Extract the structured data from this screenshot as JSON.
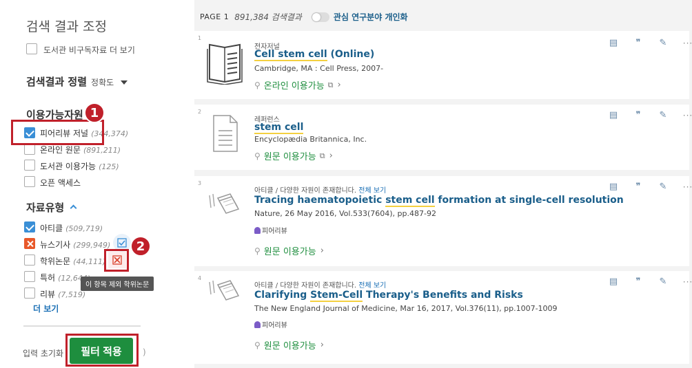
{
  "sidebar": {
    "title": "검색 결과 조정",
    "library_nonsub": "도서관 비구독자료 더 보기",
    "sort": {
      "title": "검색결과 정렬",
      "value": "정확도"
    },
    "availability": {
      "title": "이용가능자원",
      "items": [
        {
          "label": "피어리뷰 저널",
          "count": "(344,374)"
        },
        {
          "label": "온라인 원문",
          "count": "(891,211)"
        },
        {
          "label": "도서관 이용가능",
          "count": "(125)"
        },
        {
          "label": "오픈 액세스",
          "count": ""
        }
      ]
    },
    "rtype": {
      "title": "자료유형",
      "items": [
        {
          "label": "아티클",
          "count": "(509,719)"
        },
        {
          "label": "뉴스기사",
          "count": "(299,949)"
        },
        {
          "label": "학위논문",
          "count": "(44,111)"
        },
        {
          "label": "특허",
          "count": "(12,644)"
        },
        {
          "label": "리뷰",
          "count": "(7,519)"
        }
      ]
    },
    "more_label": "더 보기",
    "tooltip": "이 항목 제외 학위논문",
    "reset_label": "입력 초기화",
    "apply_label": "필터 적용",
    "paren": ")",
    "badges": [
      "1",
      "2"
    ]
  },
  "main": {
    "page_label": "PAGE 1",
    "result_count": "891,384 검색결과",
    "personalize_label": "관심 연구분야 개인화",
    "results": [
      {
        "num": "1",
        "type": "전자저널",
        "title_pre": "",
        "title_hl": "Cell stem cell",
        "title_post": " (Online)",
        "pub": "Cambridge, MA : Cell Press, 2007-",
        "peer": "",
        "avail": "온라인 이용가능"
      },
      {
        "num": "2",
        "type": "레퍼런스",
        "title_pre": "",
        "title_hl": "stem cell",
        "title_post": "",
        "pub": "Encyclopædia Britannica, Inc.",
        "peer": "",
        "avail": "원문 이용가능"
      },
      {
        "num": "3",
        "type": "아티클 / 다양한 자원이 존재합니다.",
        "type_link": "전체 보기",
        "title_pre": "Tracing haematopoietic ",
        "title_hl": "stem cell",
        "title_post": " formation at single-cell resolution",
        "pub": "Nature, 26 May 2016, Vol.533(7604), pp.487-92",
        "peer": "피어리뷰",
        "avail": "원문 이용가능"
      },
      {
        "num": "4",
        "type": "아티클 / 다양한 자원이 존재합니다.",
        "type_link": "전체 보기",
        "title_pre": "Clarifying ",
        "title_hl": "Stem-Cell",
        "title_post": " Therapy's Benefits and Risks",
        "pub": "The New England Journal of Medicine, Mar 16, 2017, Vol.376(11), pp.1007-1009",
        "peer": "피어리뷰",
        "avail": "원문 이용가능"
      }
    ]
  }
}
